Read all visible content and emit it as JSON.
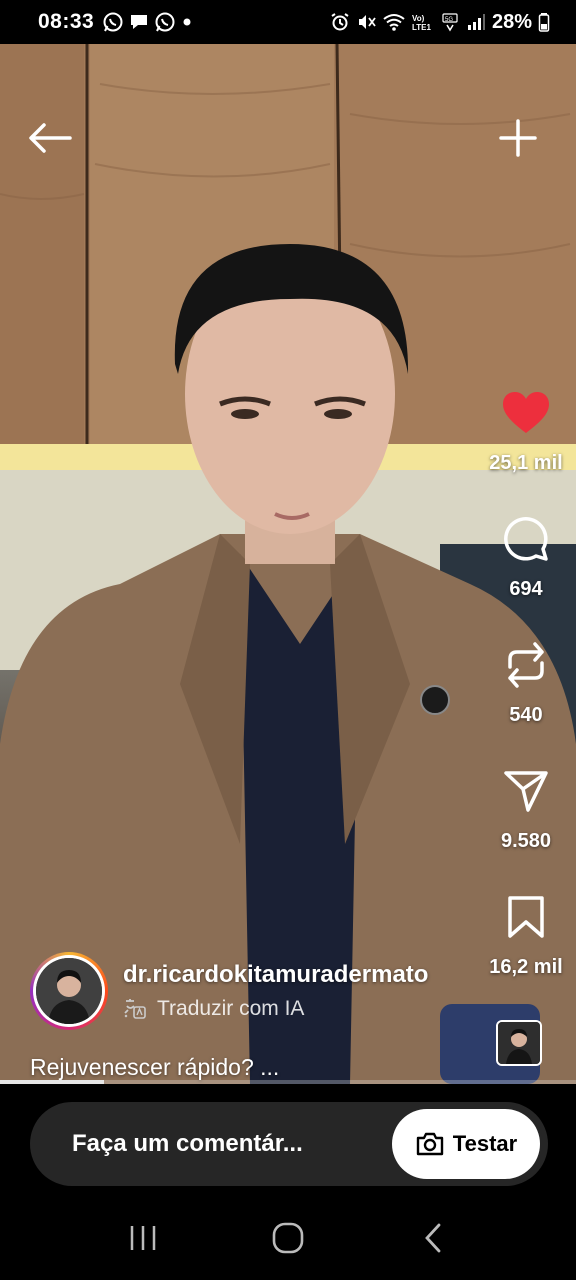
{
  "status_bar": {
    "time": "08:33",
    "battery": "28%",
    "notification_icons": [
      "whatsapp-icon",
      "chat-icon",
      "whatsapp-icon",
      "dot-icon"
    ],
    "system_icons": [
      "alarm-icon",
      "mute-icon",
      "wifi-icon",
      "volte-icon",
      "signal-icon",
      "battery-icon"
    ]
  },
  "reel": {
    "username": "dr.ricardokitamuradermato",
    "translate_label": "Traduzir com IA",
    "caption": "Rejuvenescer rápido? ...",
    "progress": 0.18,
    "liked": true,
    "counts": {
      "likes": "25,1 mil",
      "comments": "694",
      "reposts": "540",
      "shares": "9.580",
      "saves": "16,2 mil"
    }
  },
  "comment_bar": {
    "placeholder": "Faça um comentár...",
    "try_label": "Testar"
  },
  "colors": {
    "like": "#ed2f3d",
    "comment_bar": "#262626"
  }
}
